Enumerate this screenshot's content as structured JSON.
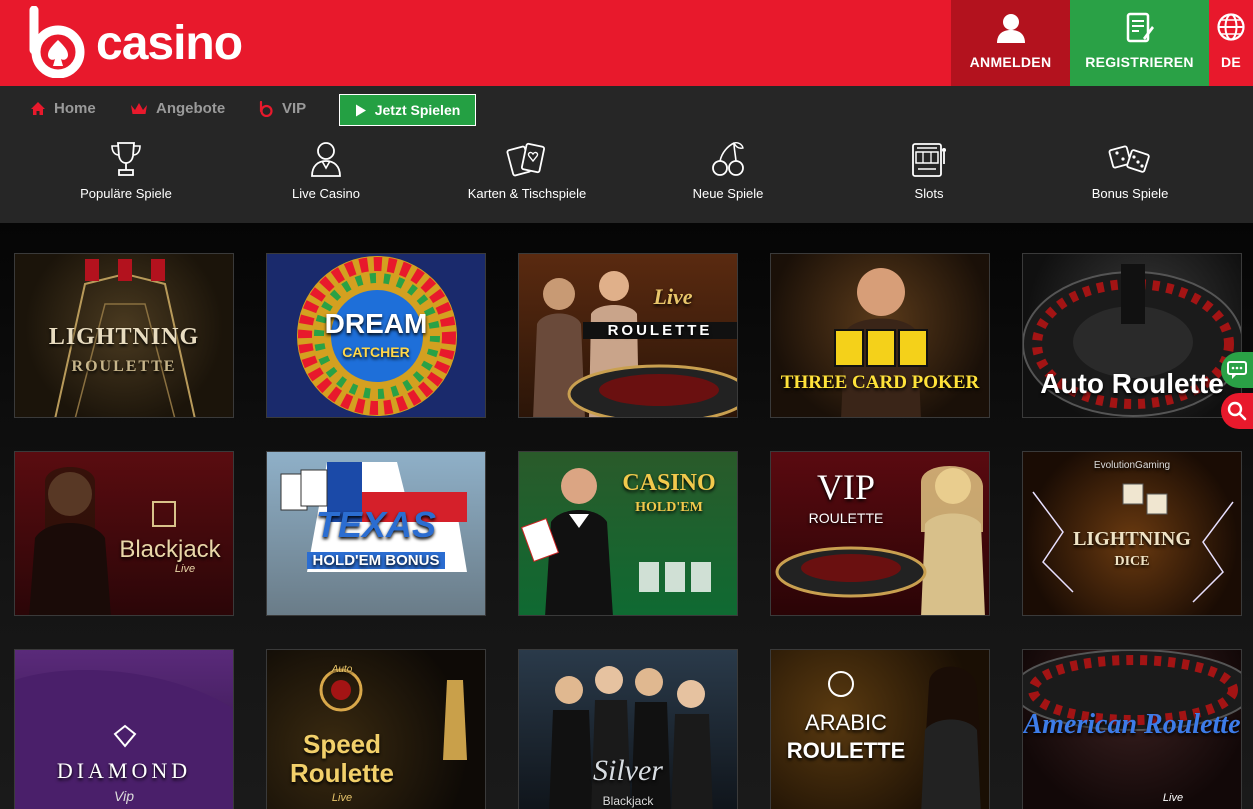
{
  "header": {
    "logo_text": "casino",
    "login_label": "ANMELDEN",
    "register_label": "REGISTRIEREN",
    "lang_label": "DE"
  },
  "topnav": {
    "home": "Home",
    "offers": "Angebote",
    "vip": "VIP",
    "play_now": "Jetzt Spielen"
  },
  "categories": [
    {
      "label": "Populäre Spiele",
      "icon": "trophy-icon"
    },
    {
      "label": "Live Casino",
      "icon": "dealer-icon"
    },
    {
      "label": "Karten & Tischspiele",
      "icon": "cards-icon"
    },
    {
      "label": "Neue Spiele",
      "icon": "cherries-icon"
    },
    {
      "label": "Slots",
      "icon": "slot-machine-icon"
    },
    {
      "label": "Bonus Spiele",
      "icon": "dice-icon"
    }
  ],
  "games": [
    {
      "title": "LIGHTNING",
      "sub": "ROULETTE"
    },
    {
      "title": "DREAM",
      "sub": "CATCHER"
    },
    {
      "title": "Live",
      "sub": "ROULETTE"
    },
    {
      "title": "THREE CARD POKER",
      "sub": ""
    },
    {
      "title": "Auto Roulette",
      "sub": ""
    },
    {
      "title": "Blackjack",
      "sub": "Live"
    },
    {
      "title": "TEXAS",
      "sub": "HOLD'EM BONUS"
    },
    {
      "title": "CASINO",
      "sub": "HOLD'EM"
    },
    {
      "title": "VIP",
      "sub": "ROULETTE"
    },
    {
      "title": "LIGHTNING",
      "sub": "DICE",
      "brand": "EvolutionGaming"
    },
    {
      "title": "DIAMOND",
      "sub": "Vip"
    },
    {
      "title": "Speed Roulette",
      "sub": "Live",
      "top": "Auto"
    },
    {
      "title": "Silver",
      "sub": "Blackjack"
    },
    {
      "title": "ARABIC",
      "sub": "ROULETTE"
    },
    {
      "title": "American Roulette",
      "sub": "Live"
    }
  ],
  "colors": {
    "brand_red": "#e8192c",
    "login_dark_red": "#b3121e",
    "register_green": "#2aa146",
    "nav_bg": "#262626"
  }
}
